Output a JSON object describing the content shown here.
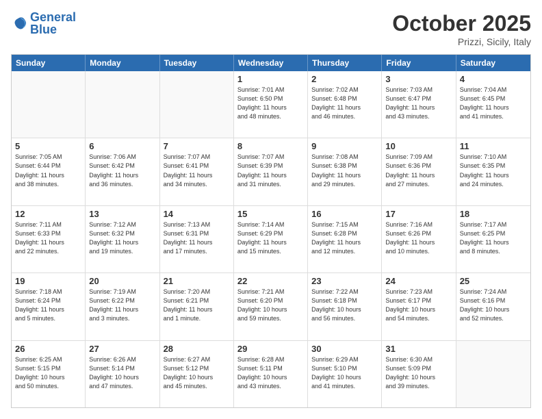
{
  "header": {
    "logo_general": "General",
    "logo_blue": "Blue",
    "month": "October 2025",
    "location": "Prizzi, Sicily, Italy"
  },
  "days_of_week": [
    "Sunday",
    "Monday",
    "Tuesday",
    "Wednesday",
    "Thursday",
    "Friday",
    "Saturday"
  ],
  "weeks": [
    [
      {
        "day": "",
        "text": ""
      },
      {
        "day": "",
        "text": ""
      },
      {
        "day": "",
        "text": ""
      },
      {
        "day": "1",
        "text": "Sunrise: 7:01 AM\nSunset: 6:50 PM\nDaylight: 11 hours\nand 48 minutes."
      },
      {
        "day": "2",
        "text": "Sunrise: 7:02 AM\nSunset: 6:48 PM\nDaylight: 11 hours\nand 46 minutes."
      },
      {
        "day": "3",
        "text": "Sunrise: 7:03 AM\nSunset: 6:47 PM\nDaylight: 11 hours\nand 43 minutes."
      },
      {
        "day": "4",
        "text": "Sunrise: 7:04 AM\nSunset: 6:45 PM\nDaylight: 11 hours\nand 41 minutes."
      }
    ],
    [
      {
        "day": "5",
        "text": "Sunrise: 7:05 AM\nSunset: 6:44 PM\nDaylight: 11 hours\nand 38 minutes."
      },
      {
        "day": "6",
        "text": "Sunrise: 7:06 AM\nSunset: 6:42 PM\nDaylight: 11 hours\nand 36 minutes."
      },
      {
        "day": "7",
        "text": "Sunrise: 7:07 AM\nSunset: 6:41 PM\nDaylight: 11 hours\nand 34 minutes."
      },
      {
        "day": "8",
        "text": "Sunrise: 7:07 AM\nSunset: 6:39 PM\nDaylight: 11 hours\nand 31 minutes."
      },
      {
        "day": "9",
        "text": "Sunrise: 7:08 AM\nSunset: 6:38 PM\nDaylight: 11 hours\nand 29 minutes."
      },
      {
        "day": "10",
        "text": "Sunrise: 7:09 AM\nSunset: 6:36 PM\nDaylight: 11 hours\nand 27 minutes."
      },
      {
        "day": "11",
        "text": "Sunrise: 7:10 AM\nSunset: 6:35 PM\nDaylight: 11 hours\nand 24 minutes."
      }
    ],
    [
      {
        "day": "12",
        "text": "Sunrise: 7:11 AM\nSunset: 6:33 PM\nDaylight: 11 hours\nand 22 minutes."
      },
      {
        "day": "13",
        "text": "Sunrise: 7:12 AM\nSunset: 6:32 PM\nDaylight: 11 hours\nand 19 minutes."
      },
      {
        "day": "14",
        "text": "Sunrise: 7:13 AM\nSunset: 6:31 PM\nDaylight: 11 hours\nand 17 minutes."
      },
      {
        "day": "15",
        "text": "Sunrise: 7:14 AM\nSunset: 6:29 PM\nDaylight: 11 hours\nand 15 minutes."
      },
      {
        "day": "16",
        "text": "Sunrise: 7:15 AM\nSunset: 6:28 PM\nDaylight: 11 hours\nand 12 minutes."
      },
      {
        "day": "17",
        "text": "Sunrise: 7:16 AM\nSunset: 6:26 PM\nDaylight: 11 hours\nand 10 minutes."
      },
      {
        "day": "18",
        "text": "Sunrise: 7:17 AM\nSunset: 6:25 PM\nDaylight: 11 hours\nand 8 minutes."
      }
    ],
    [
      {
        "day": "19",
        "text": "Sunrise: 7:18 AM\nSunset: 6:24 PM\nDaylight: 11 hours\nand 5 minutes."
      },
      {
        "day": "20",
        "text": "Sunrise: 7:19 AM\nSunset: 6:22 PM\nDaylight: 11 hours\nand 3 minutes."
      },
      {
        "day": "21",
        "text": "Sunrise: 7:20 AM\nSunset: 6:21 PM\nDaylight: 11 hours\nand 1 minute."
      },
      {
        "day": "22",
        "text": "Sunrise: 7:21 AM\nSunset: 6:20 PM\nDaylight: 10 hours\nand 59 minutes."
      },
      {
        "day": "23",
        "text": "Sunrise: 7:22 AM\nSunset: 6:18 PM\nDaylight: 10 hours\nand 56 minutes."
      },
      {
        "day": "24",
        "text": "Sunrise: 7:23 AM\nSunset: 6:17 PM\nDaylight: 10 hours\nand 54 minutes."
      },
      {
        "day": "25",
        "text": "Sunrise: 7:24 AM\nSunset: 6:16 PM\nDaylight: 10 hours\nand 52 minutes."
      }
    ],
    [
      {
        "day": "26",
        "text": "Sunrise: 6:25 AM\nSunset: 5:15 PM\nDaylight: 10 hours\nand 50 minutes."
      },
      {
        "day": "27",
        "text": "Sunrise: 6:26 AM\nSunset: 5:14 PM\nDaylight: 10 hours\nand 47 minutes."
      },
      {
        "day": "28",
        "text": "Sunrise: 6:27 AM\nSunset: 5:12 PM\nDaylight: 10 hours\nand 45 minutes."
      },
      {
        "day": "29",
        "text": "Sunrise: 6:28 AM\nSunset: 5:11 PM\nDaylight: 10 hours\nand 43 minutes."
      },
      {
        "day": "30",
        "text": "Sunrise: 6:29 AM\nSunset: 5:10 PM\nDaylight: 10 hours\nand 41 minutes."
      },
      {
        "day": "31",
        "text": "Sunrise: 6:30 AM\nSunset: 5:09 PM\nDaylight: 10 hours\nand 39 minutes."
      },
      {
        "day": "",
        "text": ""
      }
    ]
  ]
}
